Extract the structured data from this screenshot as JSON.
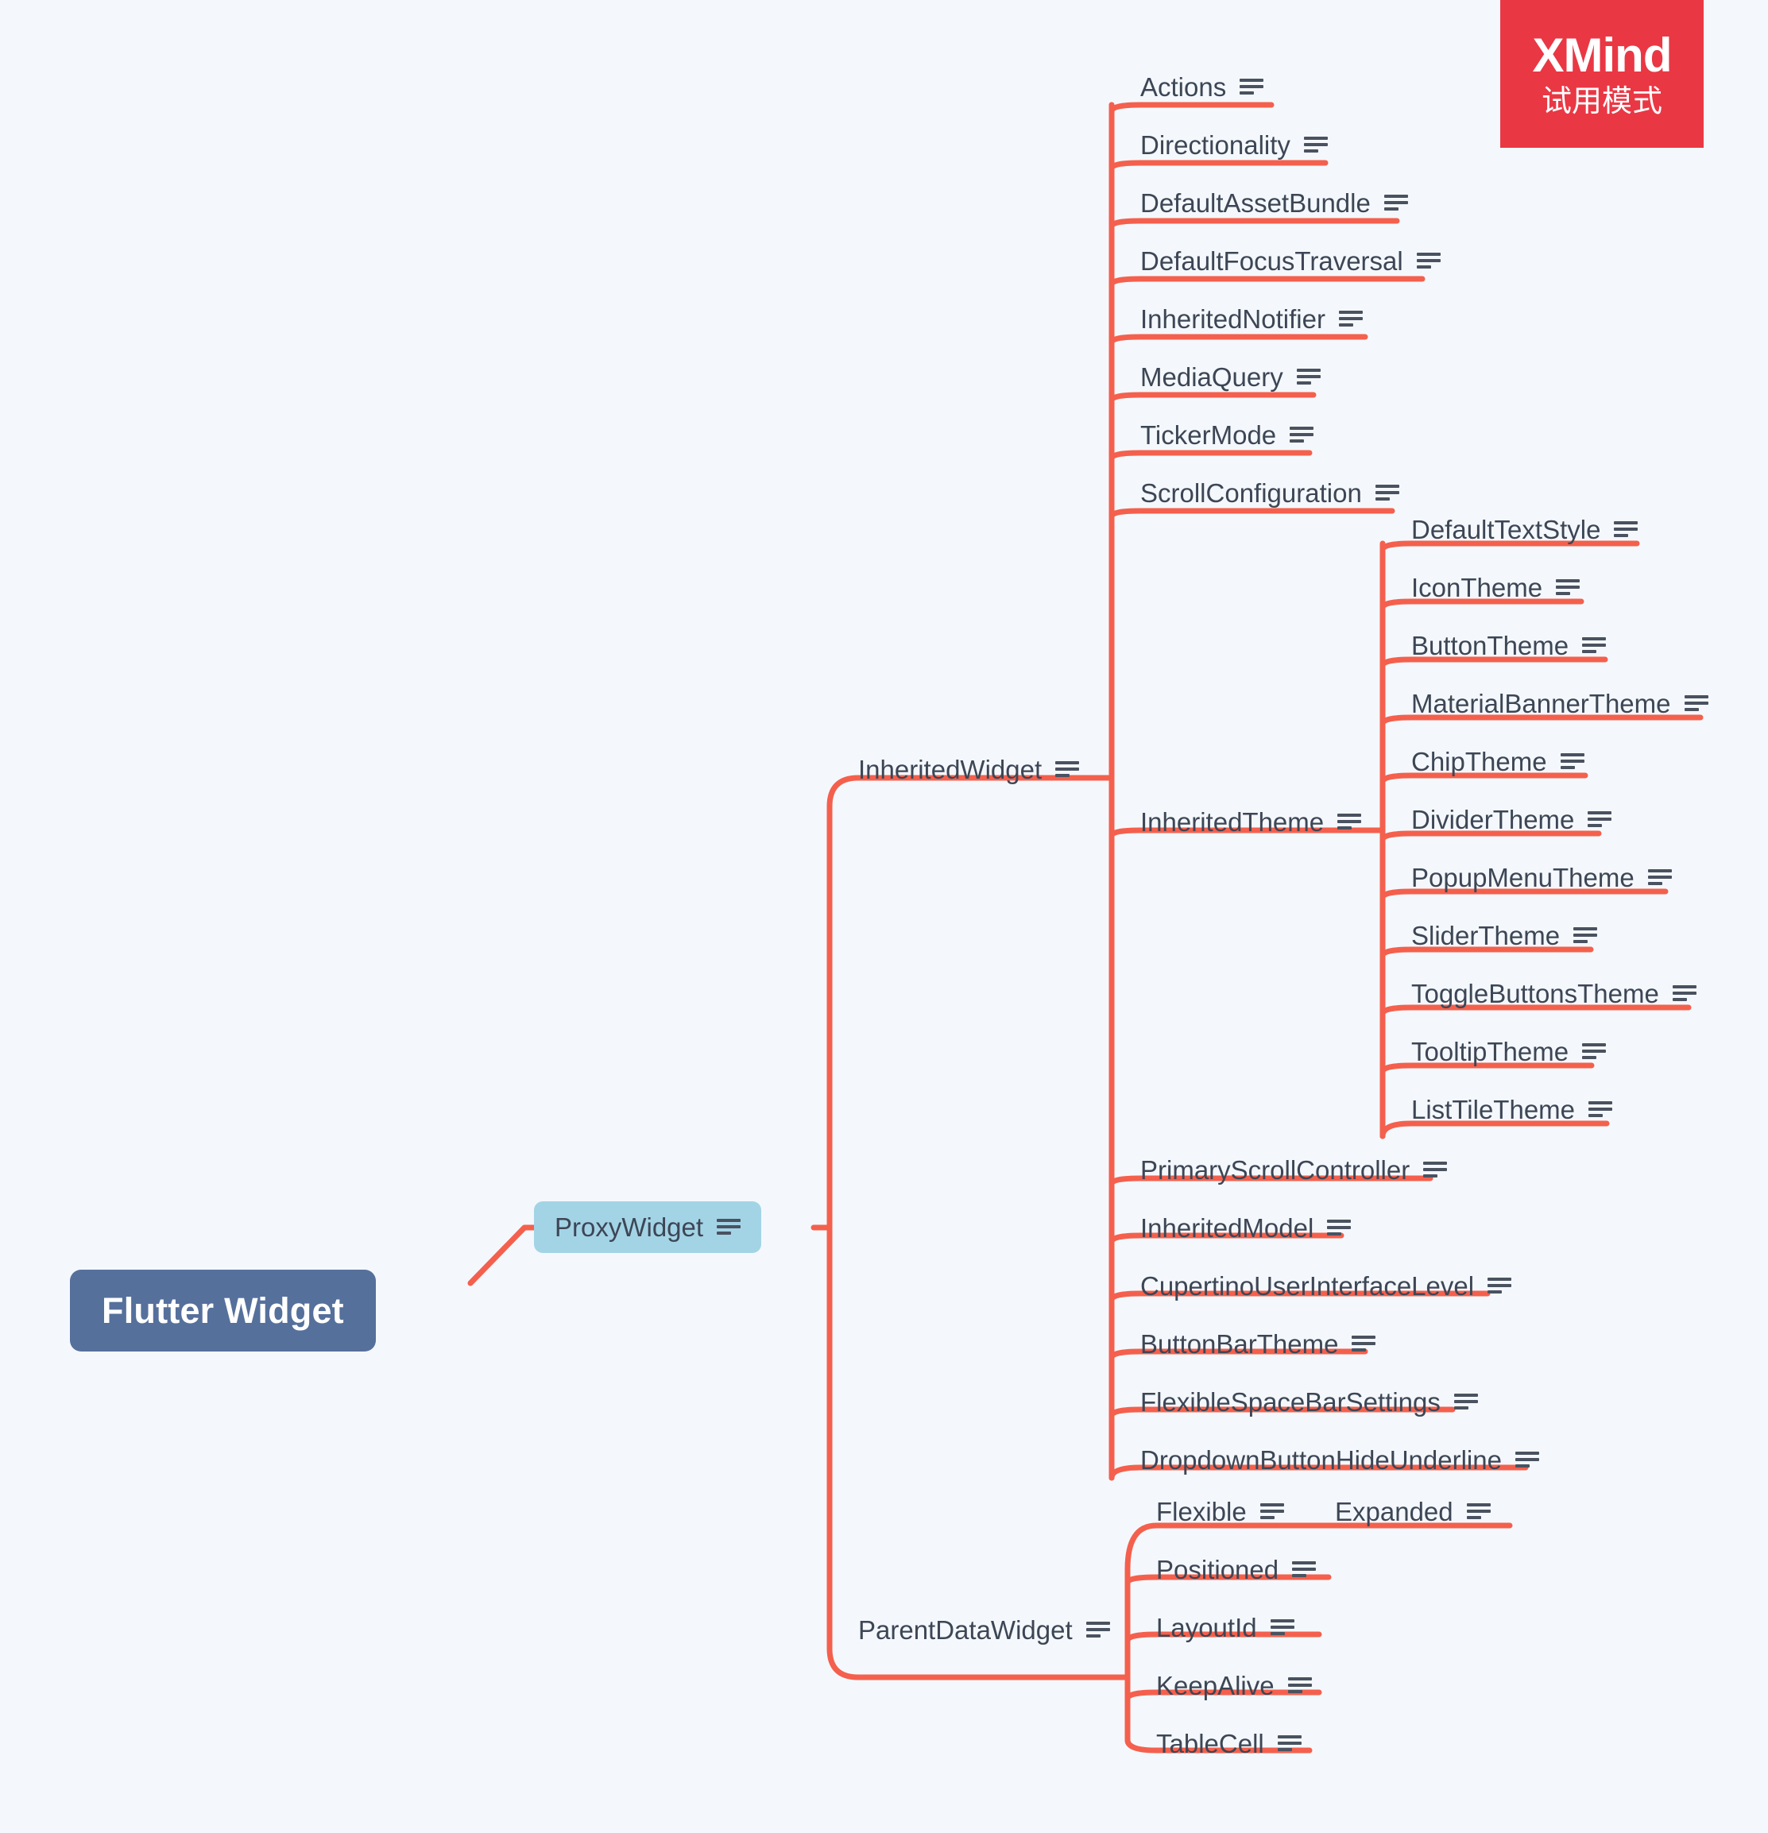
{
  "watermark": {
    "brand": "XMind",
    "mode": "试用模式",
    "color": "#ea3744"
  },
  "theme": {
    "background": "#f4f8fc",
    "link_color": "#f4604d",
    "root_fill": "#56709c",
    "root_text": "#ffffff",
    "branch_fill": "#a3d4e6",
    "text_color": "#3d4655",
    "note_icon": "notes-icon"
  },
  "mindmap": {
    "root": {
      "label": "Flutter Widget"
    },
    "level1": {
      "label": "ProxyWidget",
      "icon": "notes-icon"
    },
    "branches": [
      {
        "label": "InheritedWidget",
        "icon": "notes-icon"
      },
      {
        "label": "ParentDataWidget",
        "icon": "notes-icon"
      }
    ],
    "inherited_widget_children": [
      {
        "label": "Actions",
        "icon": "notes-icon"
      },
      {
        "label": "Directionality",
        "icon": "notes-icon"
      },
      {
        "label": "DefaultAssetBundle",
        "icon": "notes-icon"
      },
      {
        "label": "DefaultFocusTraversal",
        "icon": "notes-icon"
      },
      {
        "label": "InheritedNotifier",
        "icon": "notes-icon"
      },
      {
        "label": "MediaQuery",
        "icon": "notes-icon"
      },
      {
        "label": "TickerMode",
        "icon": "notes-icon"
      },
      {
        "label": "ScrollConfiguration",
        "icon": "notes-icon"
      },
      {
        "label": "InheritedTheme",
        "icon": "notes-icon"
      },
      {
        "label": "PrimaryScrollController",
        "icon": "notes-icon"
      },
      {
        "label": "InheritedModel",
        "icon": "notes-icon"
      },
      {
        "label": "CupertinoUserInterfaceLevel",
        "icon": "notes-icon"
      },
      {
        "label": "ButtonBarTheme",
        "icon": "notes-icon"
      },
      {
        "label": "FlexibleSpaceBarSettings",
        "icon": "notes-icon"
      },
      {
        "label": "DropdownButtonHideUnderline",
        "icon": "notes-icon"
      }
    ],
    "inherited_theme_children": [
      {
        "label": "DefaultTextStyle",
        "icon": "notes-icon"
      },
      {
        "label": "IconTheme",
        "icon": "notes-icon"
      },
      {
        "label": "ButtonTheme",
        "icon": "notes-icon"
      },
      {
        "label": "MaterialBannerTheme",
        "icon": "notes-icon"
      },
      {
        "label": "ChipTheme",
        "icon": "notes-icon"
      },
      {
        "label": "DividerTheme",
        "icon": "notes-icon"
      },
      {
        "label": "PopupMenuTheme",
        "icon": "notes-icon"
      },
      {
        "label": "SliderTheme",
        "icon": "notes-icon"
      },
      {
        "label": "ToggleButtonsTheme",
        "icon": "notes-icon"
      },
      {
        "label": "TooltipTheme",
        "icon": "notes-icon"
      },
      {
        "label": "ListTileTheme",
        "icon": "notes-icon"
      }
    ],
    "parent_data_widget_children": [
      {
        "label": "Flexible",
        "icon": "notes-icon"
      },
      {
        "label": "Positioned",
        "icon": "notes-icon"
      },
      {
        "label": "LayoutId",
        "icon": "notes-icon"
      },
      {
        "label": "KeepAlive",
        "icon": "notes-icon"
      },
      {
        "label": "TableCell",
        "icon": "notes-icon"
      }
    ],
    "flexible_children": [
      {
        "label": "Expanded",
        "icon": "notes-icon"
      }
    ]
  }
}
